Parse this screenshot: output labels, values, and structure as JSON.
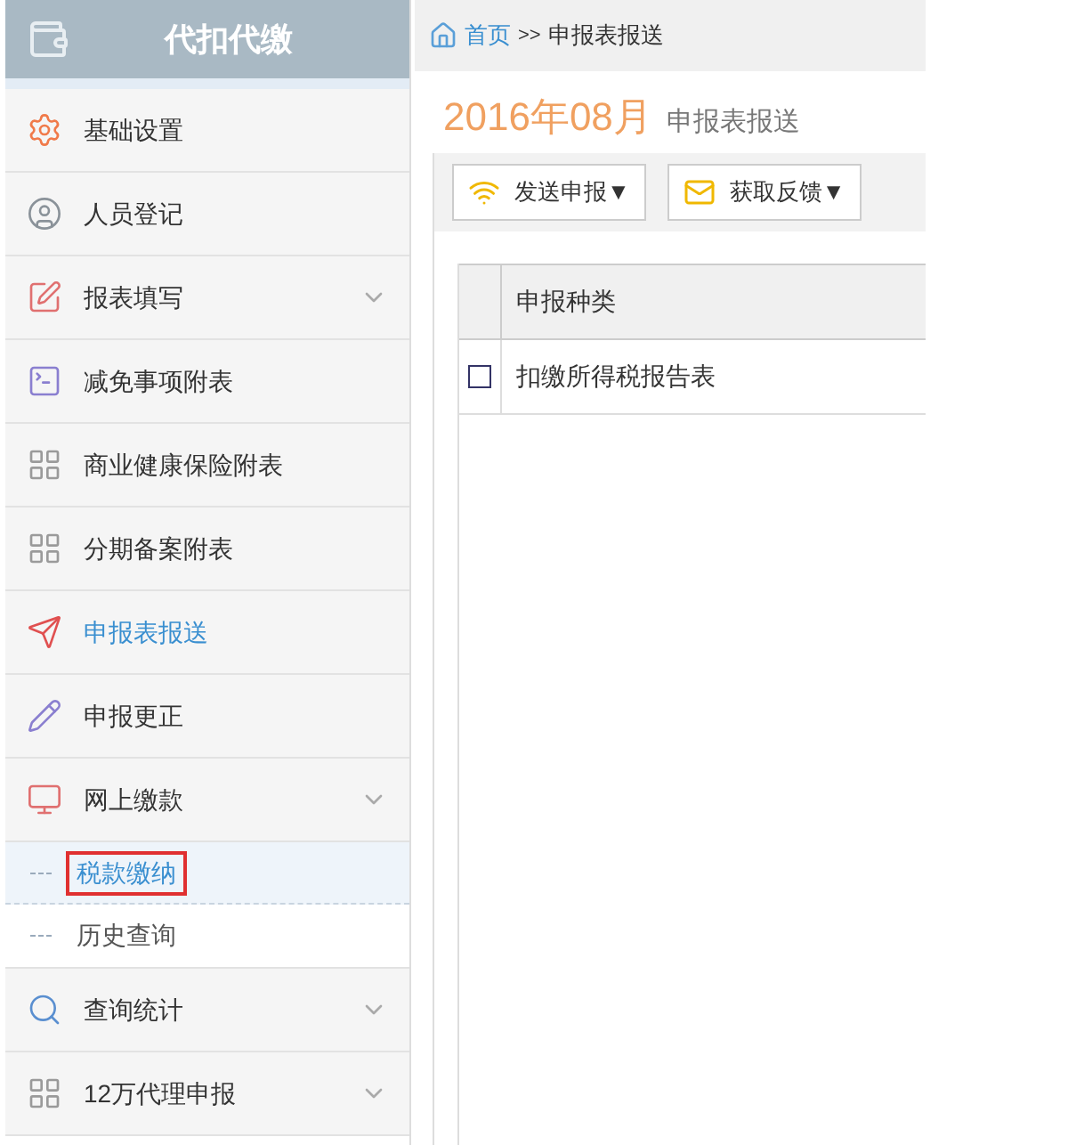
{
  "sidebar": {
    "title": "代扣代缴",
    "items": [
      {
        "label": "基础设置",
        "selected": false
      },
      {
        "label": "人员登记",
        "selected": false
      },
      {
        "label": "报表填写",
        "selected": false,
        "kind": "group"
      },
      {
        "label": "减免事项附表",
        "selected": false
      },
      {
        "label": "商业健康保险附表",
        "selected": false
      },
      {
        "label": "分期备案附表",
        "selected": false
      },
      {
        "label": "申报表报送",
        "selected": true
      },
      {
        "label": "申报更正",
        "selected": false
      },
      {
        "label": "网上缴款",
        "selected": false,
        "kind": "group",
        "children": [
          {
            "label": "税款缴纳",
            "selected": true
          },
          {
            "label": "历史查询",
            "selected": false
          }
        ]
      },
      {
        "label": "查询统计",
        "selected": false,
        "kind": "group"
      },
      {
        "label": "12万代理申报",
        "selected": false,
        "kind": "group"
      }
    ]
  },
  "breadcrumb": {
    "home": "首页",
    "separator": ">>",
    "current": "申报表报送"
  },
  "heading": {
    "period": "2016年08月",
    "title": "申报表报送"
  },
  "toolbar": [
    {
      "label": "发送申报▼"
    },
    {
      "label": "获取反馈▼"
    }
  ],
  "table": {
    "columns": [
      "申报种类"
    ],
    "rows": [
      {
        "checked": false,
        "cells": [
          "扣缴所得税报告表"
        ]
      }
    ]
  }
}
